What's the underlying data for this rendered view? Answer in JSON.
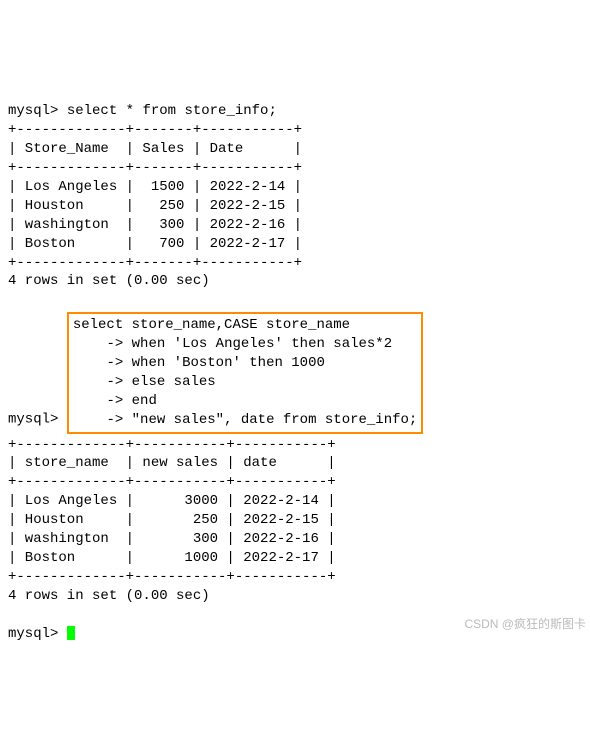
{
  "prompt": "mysql>",
  "continuation": "->",
  "query1": "select * from store_info;",
  "table1": {
    "div": "+-------------+-------+-----------+",
    "header": "| Store_Name  | Sales | Date      |",
    "rows": [
      "| Los Angeles |  1500 | 2022-2-14 |",
      "| Houston     |   250 | 2022-2-15 |",
      "| washington  |   300 | 2022-2-16 |",
      "| Boston      |   700 | 2022-2-17 |"
    ]
  },
  "rows_msg1": "4 rows in set (0.00 sec)",
  "query2_lines": [
    "select store_name,CASE store_name",
    "when 'Los Angeles' then sales*2",
    "when 'Boston' then 1000",
    "else sales",
    "end",
    "\"new sales\", date from store_info;"
  ],
  "table2": {
    "div": "+-------------+-----------+-----------+",
    "header": "| store_name  | new sales | date      |",
    "rows": [
      "| Los Angeles |      3000 | 2022-2-14 |",
      "| Houston     |       250 | 2022-2-15 |",
      "| washington  |       300 | 2022-2-16 |",
      "| Boston      |      1000 | 2022-2-17 |"
    ]
  },
  "rows_msg2": "4 rows in set (0.00 sec)",
  "watermark": "CSDN @疯狂的斯图卡",
  "chart_data": [
    {
      "type": "table",
      "title": "store_info (query 1)",
      "columns": [
        "Store_Name",
        "Sales",
        "Date"
      ],
      "rows": [
        [
          "Los Angeles",
          1500,
          "2022-2-14"
        ],
        [
          "Houston",
          250,
          "2022-2-15"
        ],
        [
          "washington",
          300,
          "2022-2-16"
        ],
        [
          "Boston",
          700,
          "2022-2-17"
        ]
      ]
    },
    {
      "type": "table",
      "title": "CASE result (query 2)",
      "columns": [
        "store_name",
        "new sales",
        "date"
      ],
      "rows": [
        [
          "Los Angeles",
          3000,
          "2022-2-14"
        ],
        [
          "Houston",
          250,
          "2022-2-15"
        ],
        [
          "washington",
          300,
          "2022-2-16"
        ],
        [
          "Boston",
          1000,
          "2022-2-17"
        ]
      ]
    }
  ]
}
